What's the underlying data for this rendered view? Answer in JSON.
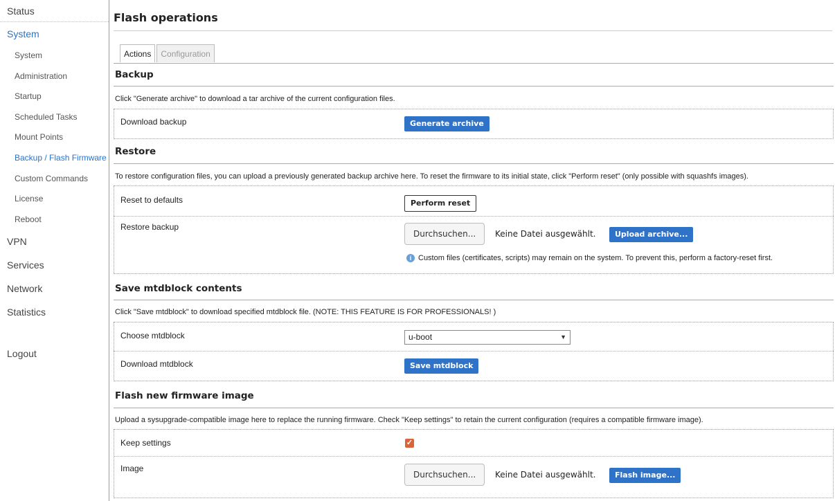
{
  "sidebar": {
    "status": "Status",
    "system": "System",
    "sub": [
      "System",
      "Administration",
      "Startup",
      "Scheduled Tasks",
      "Mount Points",
      "Backup / Flash Firmware",
      "Custom Commands",
      "License",
      "Reboot"
    ],
    "vpn": "VPN",
    "services": "Services",
    "network": "Network",
    "statistics": "Statistics",
    "logout": "Logout"
  },
  "page": {
    "title": "Flash operations",
    "tabs": [
      "Actions",
      "Configuration"
    ]
  },
  "backup": {
    "title": "Backup",
    "desc": "Click \"Generate archive\" to download a tar archive of the current configuration files.",
    "download_label": "Download backup",
    "generate_button": "Generate archive"
  },
  "restore": {
    "title": "Restore",
    "desc": "To restore configuration files, you can upload a previously generated backup archive here. To reset the firmware to its initial state, click \"Perform reset\" (only possible with squashfs images).",
    "reset_label": "Reset to defaults",
    "reset_button": "Perform reset",
    "restore_label": "Restore backup",
    "browse_button": "Durchsuchen...",
    "file_status": "Keine Datei ausgewählt.",
    "upload_button": "Upload archive...",
    "hint": "Custom files (certificates, scripts) may remain on the system. To prevent this, perform a factory-reset first."
  },
  "mtd": {
    "title": "Save mtdblock contents",
    "desc": "Click \"Save mtdblock\" to download specified mtdblock file. (NOTE: THIS FEATURE IS FOR PROFESSIONALS! )",
    "choose_label": "Choose mtdblock",
    "selected": "u-boot",
    "download_label": "Download mtdblock",
    "save_button": "Save mtdblock"
  },
  "flash": {
    "title": "Flash new firmware image",
    "desc": "Upload a sysupgrade-compatible image here to replace the running firmware. Check \"Keep settings\" to retain the current configuration (requires a compatible firmware image).",
    "keep_label": "Keep settings",
    "keep_checked": true,
    "image_label": "Image",
    "browse_button": "Durchsuchen...",
    "file_status": "Keine Datei ausgewählt.",
    "flash_button": "Flash image..."
  }
}
